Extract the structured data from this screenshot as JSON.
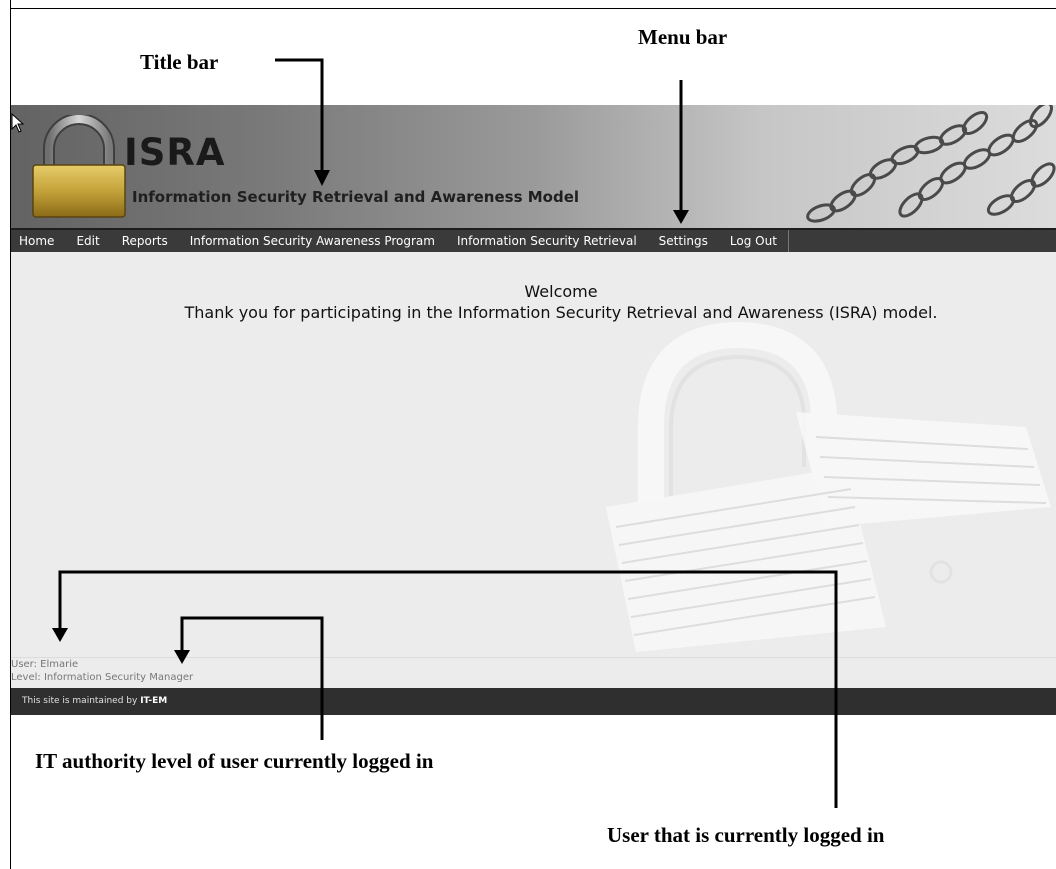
{
  "annotations": {
    "title_bar": "Title bar",
    "menu_bar": "Menu bar",
    "authority_level": "IT authority level of user currently logged in",
    "current_user": "User that is currently logged in"
  },
  "app": {
    "title": "ISRA",
    "subtitle": "Information Security Retrieval and Awareness Model",
    "menu": [
      "Home",
      "Edit",
      "Reports",
      "Information Security Awareness Program",
      "Information Security Retrieval",
      "Settings",
      "Log Out"
    ],
    "welcome": "Welcome",
    "message": "Thank you for participating in the Information Security Retrieval and Awareness (ISRA) model.",
    "user_line": "User: Elmarie",
    "level_line": "Level: Information Security Manager",
    "footer_prefix": "This site is maintained by",
    "footer_org": "IT-EM"
  },
  "colors": {
    "menu_bar": "#3a3a3a",
    "footer": "#2f2f2f",
    "content_bg": "#ececec",
    "lock_gold": "#b9952f"
  },
  "icons": [
    "padlock-icon",
    "chains-image",
    "padlock-watermark",
    "cursor-icon"
  ]
}
